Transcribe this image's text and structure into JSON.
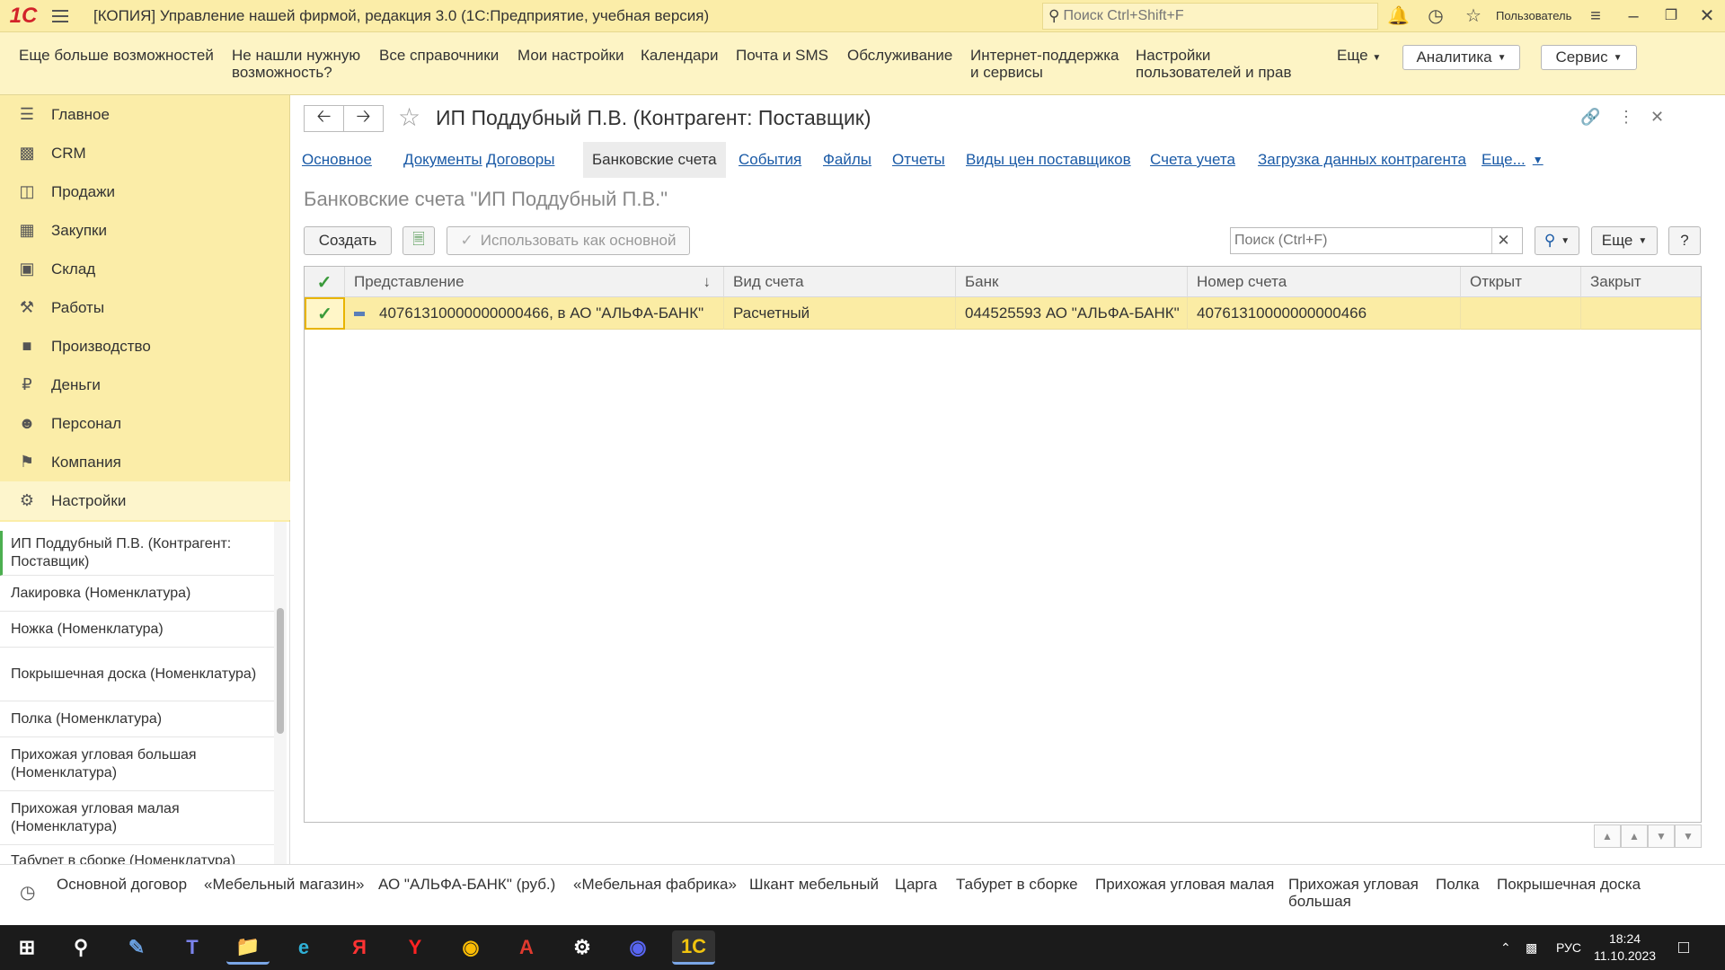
{
  "titlebar": {
    "logo": "1С",
    "title": "[КОПИЯ] Управление нашей фирмой, редакция 3.0  (1С:Предприятие, учебная версия)",
    "search_placeholder": "Поиск Ctrl+Shift+F",
    "user": "Пользователь"
  },
  "panel": {
    "items": [
      "Еще больше возможностей",
      "Не нашли нужную возможность?",
      "Все справочники",
      "Мои настройки",
      "Календари",
      "Почта и SMS",
      "Обслуживание",
      "Интернет-поддержка и сервисы",
      "Настройки пользователей и прав",
      "Еще"
    ],
    "analytics": "Аналитика",
    "service": "Сервис"
  },
  "sidebar": {
    "items": [
      "Главное",
      "CRM",
      "Продажи",
      "Закупки",
      "Склад",
      "Работы",
      "Производство",
      "Деньги",
      "Персонал",
      "Компания",
      "Настройки"
    ]
  },
  "open_windows": [
    "ИП Поддубный П.В. (Контрагент: Поставщик)",
    "Лакировка (Номенклатура)",
    "Ножка (Номенклатура)",
    "Покрышечная доска (Номенклатура)",
    "Полка (Номенклатура)",
    "Прихожая угловая большая (Номенклатура)",
    "Прихожая угловая малая (Номенклатура)",
    "Табурет в сборке (Номенклатура)"
  ],
  "form": {
    "title": "ИП Поддубный П.В. (Контрагент: Поставщик)",
    "tabs": [
      "Основное",
      "Документы",
      "Договоры",
      "Банковские счета",
      "События",
      "Файлы",
      "Отчеты",
      "Виды цен поставщиков",
      "Счета учета",
      "Загрузка данных контрагента",
      "Еще..."
    ],
    "subtitle": "Банковские счета \"ИП Поддубный П.В.\"",
    "create": "Создать",
    "use_main": "Использовать как основной",
    "search_placeholder": "Поиск (Ctrl+F)",
    "more": "Еще",
    "help": "?"
  },
  "table": {
    "columns": [
      "Представление",
      "Вид счета",
      "Банк",
      "Номер счета",
      "Открыт",
      "Закрыт"
    ],
    "rows": [
      {
        "name": "40761310000000000466, в АО \"АЛЬФА-БАНК\"",
        "type": "Расчетный",
        "bank": "044525593 АО \"АЛЬФА-БАНК\"",
        "number": "40761310000000000466",
        "opened": "",
        "closed": ""
      }
    ]
  },
  "history": [
    "Основной договор",
    "«Мебельный магазин»",
    "АО \"АЛЬФА-БАНК\" (руб.)",
    "«Мебельная фабрика»",
    "Шкант мебельный",
    "Царга",
    "Табурет в сборке",
    "Прихожая угловая малая",
    "Прихожая угловая большая",
    "Полка",
    "Покрышечная доска"
  ],
  "taskbar": {
    "lang": "РУС",
    "time": "18:24",
    "date": "11.10.2023"
  },
  "colors": {
    "accent": "#fbeda8",
    "link": "#1a5aa6",
    "selected_row": "#fbeca4"
  }
}
